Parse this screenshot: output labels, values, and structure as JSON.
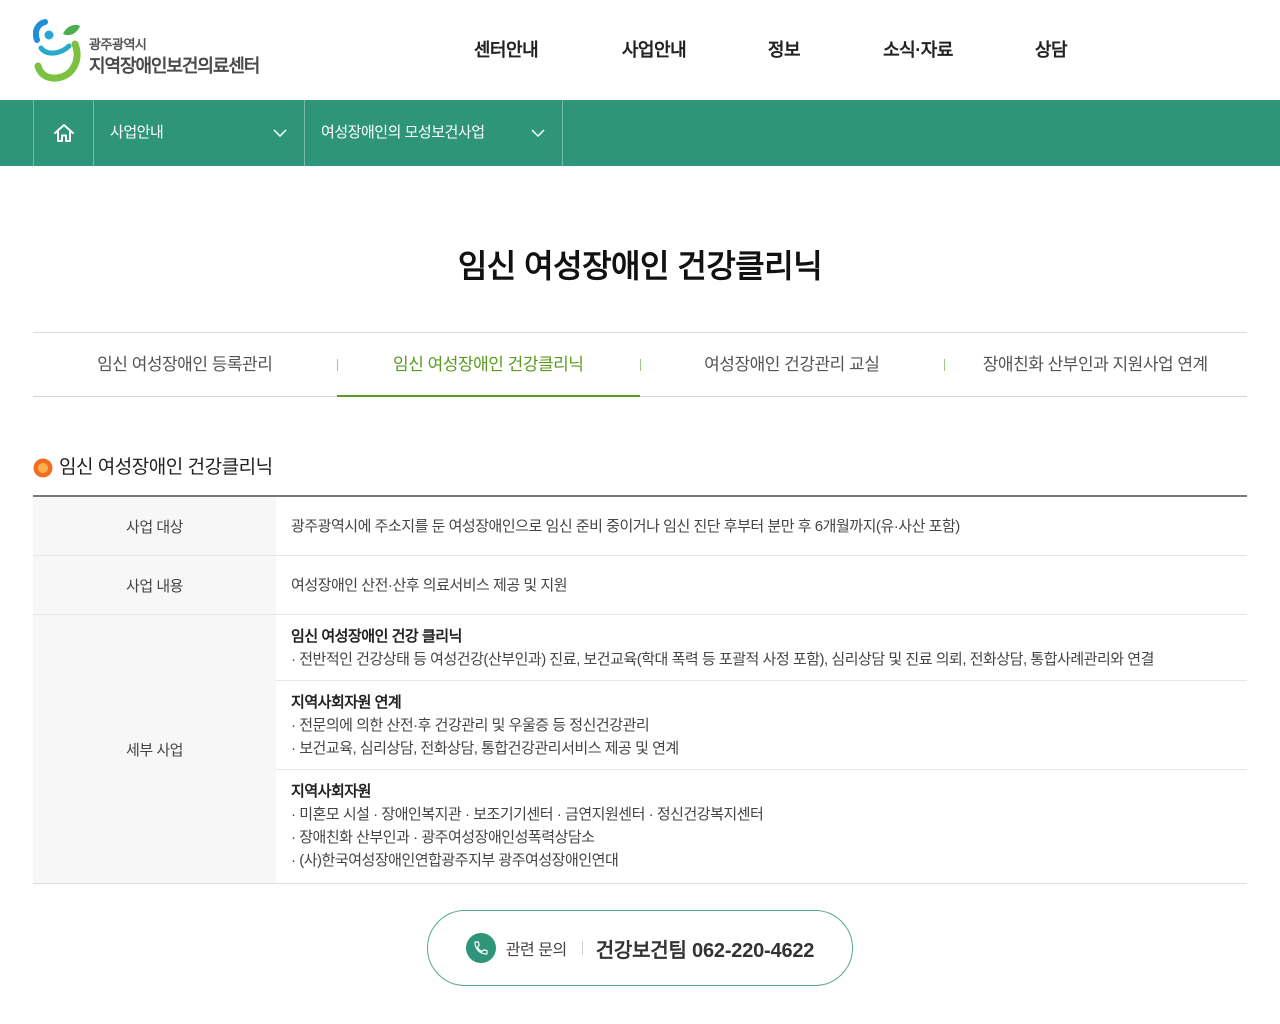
{
  "logo": {
    "top_text": "광주광역시",
    "bottom_text": "지역장애인보건의료센터",
    "icon": "logo-mark-icon"
  },
  "nav": [
    {
      "label": "센터안내"
    },
    {
      "label": "사업안내"
    },
    {
      "label": "정보"
    },
    {
      "label": "소식·자료"
    },
    {
      "label": "상담"
    }
  ],
  "breadcrumb": {
    "home_icon": "home-icon",
    "items": [
      {
        "label": "사업안내",
        "icon": "chevron-down-icon"
      },
      {
        "label": "여성장애인의 모성보건사업",
        "icon": "chevron-down-icon"
      }
    ]
  },
  "page_title": "임신 여성장애인 건강클리닉",
  "tabs": [
    {
      "label": "임신 여성장애인 등록관리",
      "active": false
    },
    {
      "label": "임신 여성장애인 건강클리닉",
      "active": true
    },
    {
      "label": "여성장애인 건강관리 교실",
      "active": false
    },
    {
      "label": "장애친화 산부인과 지원사업 연계",
      "active": false
    }
  ],
  "section": {
    "icon": "orange-circle-bullet-icon",
    "title": "임신 여성장애인 건강클리닉"
  },
  "table": {
    "rows": [
      {
        "label": "사업 대상",
        "content": "광주광역시에 주소지를 둔 여성장애인으로 임신 준비 중이거나 임신 진단 후부터 분만 후 6개월까지(유·사산 포함)"
      },
      {
        "label": "사업 내용",
        "content": "여성장애인 산전·산후 의료서비스 제공 및 지원"
      },
      {
        "label": "세부 사업",
        "blocks": [
          {
            "title": "임신 여성장애인 건강 클리닉",
            "items": [
              "· 전반적인 건강상태 등 여성건강(산부인과) 진료, 보건교육(학대 폭력 등 포괄적 사정 포함), 심리상담 및 진료 의뢰, 전화상담, 통합사례관리와 연결"
            ]
          },
          {
            "title": "지역사회자원 연계",
            "items": [
              "· 전문의에 의한 산전·후 건강관리 및 우울증 등 정신건강관리",
              "· 보건교육, 심리상담, 전화상담, 통합건강관리서비스 제공 및 연계"
            ]
          },
          {
            "title": "지역사회자원",
            "items": [
              "· 미혼모 시설 · 장애인복지관 · 보조기기센터 · 금연지원센터 · 정신건강복지센터",
              "· 장애친화 산부인과 · 광주여성장애인성폭력상담소",
              "· (사)한국여성장애인연합광주지부 광주여성장애인연대"
            ]
          }
        ]
      }
    ]
  },
  "contact": {
    "icon": "phone-icon",
    "label": "관련 문의",
    "value": "건강보건팀 062-220-4622"
  },
  "colors": {
    "brand_green": "#2e957a",
    "active_tab_green": "#5b9b1f",
    "accent_orange": "#f26d21"
  }
}
